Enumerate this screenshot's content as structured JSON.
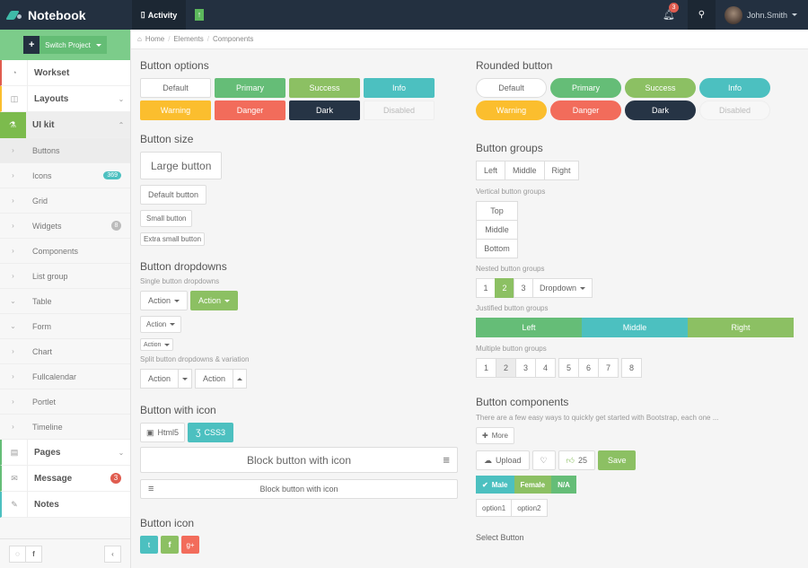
{
  "topbar": {
    "brand": "Notebook",
    "activity": "Activity",
    "notifications_count": "3",
    "user_name": "John.Smith"
  },
  "sidebar": {
    "switch_project": "Switch Project",
    "main_items": [
      {
        "label": "Workset",
        "accent": "#e05c4f"
      },
      {
        "label": "Layouts",
        "accent": "#fbbe2e"
      },
      {
        "label": "UI kit",
        "accent": "#7cbb4d"
      }
    ],
    "sub_items": [
      {
        "label": "Buttons"
      },
      {
        "label": "Icons",
        "badge": "369"
      },
      {
        "label": "Grid"
      },
      {
        "label": "Widgets",
        "badge": "8"
      },
      {
        "label": "Components"
      },
      {
        "label": "List group"
      },
      {
        "label": "Table"
      },
      {
        "label": "Form"
      },
      {
        "label": "Chart"
      },
      {
        "label": "Fullcalendar"
      },
      {
        "label": "Portlet"
      },
      {
        "label": "Timeline"
      }
    ],
    "bottom_items": [
      {
        "label": "Pages"
      },
      {
        "label": "Message",
        "badge": "3"
      },
      {
        "label": "Notes"
      }
    ]
  },
  "breadcrumb": [
    "Home",
    "Elements",
    "Components"
  ],
  "left": {
    "button_options": {
      "title": "Button options",
      "buttons": [
        "Default",
        "Primary",
        "Success",
        "Info",
        "Warning",
        "Danger",
        "Dark",
        "Disabled"
      ]
    },
    "button_size": {
      "title": "Button size",
      "large": "Large button",
      "default": "Default button",
      "small": "Small button",
      "xsmall": "Extra small button"
    },
    "button_dropdowns": {
      "title": "Button dropdowns",
      "single_label": "Single button dropdowns",
      "action": "Action",
      "split_label": "Split button dropdowns & variation"
    },
    "button_with_icon": {
      "title": "Button with icon",
      "html5": "Html5",
      "css3": "CSS3",
      "block1": "Block button with icon",
      "block2": "Block button with icon"
    },
    "button_icon": {
      "title": "Button icon"
    }
  },
  "right": {
    "rounded": {
      "title": "Rounded button",
      "buttons": [
        "Default",
        "Primary",
        "Success",
        "Info",
        "Warning",
        "Danger",
        "Dark",
        "Disabled"
      ]
    },
    "groups": {
      "title": "Button groups",
      "horizontal": [
        "Left",
        "Middle",
        "Right"
      ],
      "vertical_label": "Vertical button groups",
      "vertical": [
        "Top",
        "Middle",
        "Bottom"
      ],
      "nested_label": "Nested button groups",
      "nested": [
        "1",
        "2",
        "3"
      ],
      "dropdown": "Dropdown",
      "justified_label": "Justified button groups",
      "justified": [
        "Left",
        "Middle",
        "Right"
      ],
      "multiple_label": "Multiple button groups",
      "multiple_a": [
        "1",
        "2",
        "3",
        "4"
      ],
      "multiple_b": [
        "5",
        "6",
        "7"
      ],
      "multiple_c": [
        "8"
      ]
    },
    "components": {
      "title": "Button components",
      "desc": "There are a few easy ways to quickly get started with Bootstrap, each one ...",
      "more": "More",
      "upload": "Upload",
      "likes": "25",
      "save": "Save",
      "gender": [
        "Male",
        "Female",
        "N/A"
      ],
      "options": [
        "option1",
        "option2"
      ]
    },
    "select_button": {
      "title": "Select Button"
    }
  }
}
